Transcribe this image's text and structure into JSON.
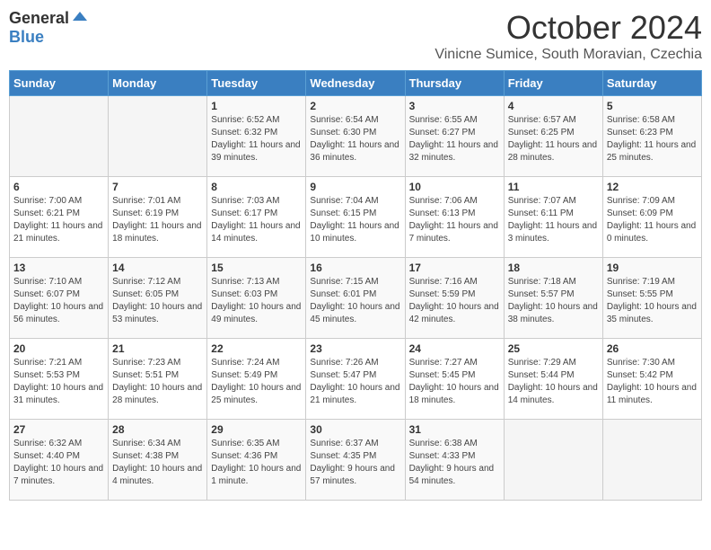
{
  "header": {
    "logo_general": "General",
    "logo_blue": "Blue",
    "month_title": "October 2024",
    "subtitle": "Vinicne Sumice, South Moravian, Czechia"
  },
  "days_of_week": [
    "Sunday",
    "Monday",
    "Tuesday",
    "Wednesday",
    "Thursday",
    "Friday",
    "Saturday"
  ],
  "weeks": [
    [
      {
        "day": "",
        "sunrise": "",
        "sunset": "",
        "daylight": ""
      },
      {
        "day": "",
        "sunrise": "",
        "sunset": "",
        "daylight": ""
      },
      {
        "day": "1",
        "sunrise": "Sunrise: 6:52 AM",
        "sunset": "Sunset: 6:32 PM",
        "daylight": "Daylight: 11 hours and 39 minutes."
      },
      {
        "day": "2",
        "sunrise": "Sunrise: 6:54 AM",
        "sunset": "Sunset: 6:30 PM",
        "daylight": "Daylight: 11 hours and 36 minutes."
      },
      {
        "day": "3",
        "sunrise": "Sunrise: 6:55 AM",
        "sunset": "Sunset: 6:27 PM",
        "daylight": "Daylight: 11 hours and 32 minutes."
      },
      {
        "day": "4",
        "sunrise": "Sunrise: 6:57 AM",
        "sunset": "Sunset: 6:25 PM",
        "daylight": "Daylight: 11 hours and 28 minutes."
      },
      {
        "day": "5",
        "sunrise": "Sunrise: 6:58 AM",
        "sunset": "Sunset: 6:23 PM",
        "daylight": "Daylight: 11 hours and 25 minutes."
      }
    ],
    [
      {
        "day": "6",
        "sunrise": "Sunrise: 7:00 AM",
        "sunset": "Sunset: 6:21 PM",
        "daylight": "Daylight: 11 hours and 21 minutes."
      },
      {
        "day": "7",
        "sunrise": "Sunrise: 7:01 AM",
        "sunset": "Sunset: 6:19 PM",
        "daylight": "Daylight: 11 hours and 18 minutes."
      },
      {
        "day": "8",
        "sunrise": "Sunrise: 7:03 AM",
        "sunset": "Sunset: 6:17 PM",
        "daylight": "Daylight: 11 hours and 14 minutes."
      },
      {
        "day": "9",
        "sunrise": "Sunrise: 7:04 AM",
        "sunset": "Sunset: 6:15 PM",
        "daylight": "Daylight: 11 hours and 10 minutes."
      },
      {
        "day": "10",
        "sunrise": "Sunrise: 7:06 AM",
        "sunset": "Sunset: 6:13 PM",
        "daylight": "Daylight: 11 hours and 7 minutes."
      },
      {
        "day": "11",
        "sunrise": "Sunrise: 7:07 AM",
        "sunset": "Sunset: 6:11 PM",
        "daylight": "Daylight: 11 hours and 3 minutes."
      },
      {
        "day": "12",
        "sunrise": "Sunrise: 7:09 AM",
        "sunset": "Sunset: 6:09 PM",
        "daylight": "Daylight: 11 hours and 0 minutes."
      }
    ],
    [
      {
        "day": "13",
        "sunrise": "Sunrise: 7:10 AM",
        "sunset": "Sunset: 6:07 PM",
        "daylight": "Daylight: 10 hours and 56 minutes."
      },
      {
        "day": "14",
        "sunrise": "Sunrise: 7:12 AM",
        "sunset": "Sunset: 6:05 PM",
        "daylight": "Daylight: 10 hours and 53 minutes."
      },
      {
        "day": "15",
        "sunrise": "Sunrise: 7:13 AM",
        "sunset": "Sunset: 6:03 PM",
        "daylight": "Daylight: 10 hours and 49 minutes."
      },
      {
        "day": "16",
        "sunrise": "Sunrise: 7:15 AM",
        "sunset": "Sunset: 6:01 PM",
        "daylight": "Daylight: 10 hours and 45 minutes."
      },
      {
        "day": "17",
        "sunrise": "Sunrise: 7:16 AM",
        "sunset": "Sunset: 5:59 PM",
        "daylight": "Daylight: 10 hours and 42 minutes."
      },
      {
        "day": "18",
        "sunrise": "Sunrise: 7:18 AM",
        "sunset": "Sunset: 5:57 PM",
        "daylight": "Daylight: 10 hours and 38 minutes."
      },
      {
        "day": "19",
        "sunrise": "Sunrise: 7:19 AM",
        "sunset": "Sunset: 5:55 PM",
        "daylight": "Daylight: 10 hours and 35 minutes."
      }
    ],
    [
      {
        "day": "20",
        "sunrise": "Sunrise: 7:21 AM",
        "sunset": "Sunset: 5:53 PM",
        "daylight": "Daylight: 10 hours and 31 minutes."
      },
      {
        "day": "21",
        "sunrise": "Sunrise: 7:23 AM",
        "sunset": "Sunset: 5:51 PM",
        "daylight": "Daylight: 10 hours and 28 minutes."
      },
      {
        "day": "22",
        "sunrise": "Sunrise: 7:24 AM",
        "sunset": "Sunset: 5:49 PM",
        "daylight": "Daylight: 10 hours and 25 minutes."
      },
      {
        "day": "23",
        "sunrise": "Sunrise: 7:26 AM",
        "sunset": "Sunset: 5:47 PM",
        "daylight": "Daylight: 10 hours and 21 minutes."
      },
      {
        "day": "24",
        "sunrise": "Sunrise: 7:27 AM",
        "sunset": "Sunset: 5:45 PM",
        "daylight": "Daylight: 10 hours and 18 minutes."
      },
      {
        "day": "25",
        "sunrise": "Sunrise: 7:29 AM",
        "sunset": "Sunset: 5:44 PM",
        "daylight": "Daylight: 10 hours and 14 minutes."
      },
      {
        "day": "26",
        "sunrise": "Sunrise: 7:30 AM",
        "sunset": "Sunset: 5:42 PM",
        "daylight": "Daylight: 10 hours and 11 minutes."
      }
    ],
    [
      {
        "day": "27",
        "sunrise": "Sunrise: 6:32 AM",
        "sunset": "Sunset: 4:40 PM",
        "daylight": "Daylight: 10 hours and 7 minutes."
      },
      {
        "day": "28",
        "sunrise": "Sunrise: 6:34 AM",
        "sunset": "Sunset: 4:38 PM",
        "daylight": "Daylight: 10 hours and 4 minutes."
      },
      {
        "day": "29",
        "sunrise": "Sunrise: 6:35 AM",
        "sunset": "Sunset: 4:36 PM",
        "daylight": "Daylight: 10 hours and 1 minute."
      },
      {
        "day": "30",
        "sunrise": "Sunrise: 6:37 AM",
        "sunset": "Sunset: 4:35 PM",
        "daylight": "Daylight: 9 hours and 57 minutes."
      },
      {
        "day": "31",
        "sunrise": "Sunrise: 6:38 AM",
        "sunset": "Sunset: 4:33 PM",
        "daylight": "Daylight: 9 hours and 54 minutes."
      },
      {
        "day": "",
        "sunrise": "",
        "sunset": "",
        "daylight": ""
      },
      {
        "day": "",
        "sunrise": "",
        "sunset": "",
        "daylight": ""
      }
    ]
  ]
}
